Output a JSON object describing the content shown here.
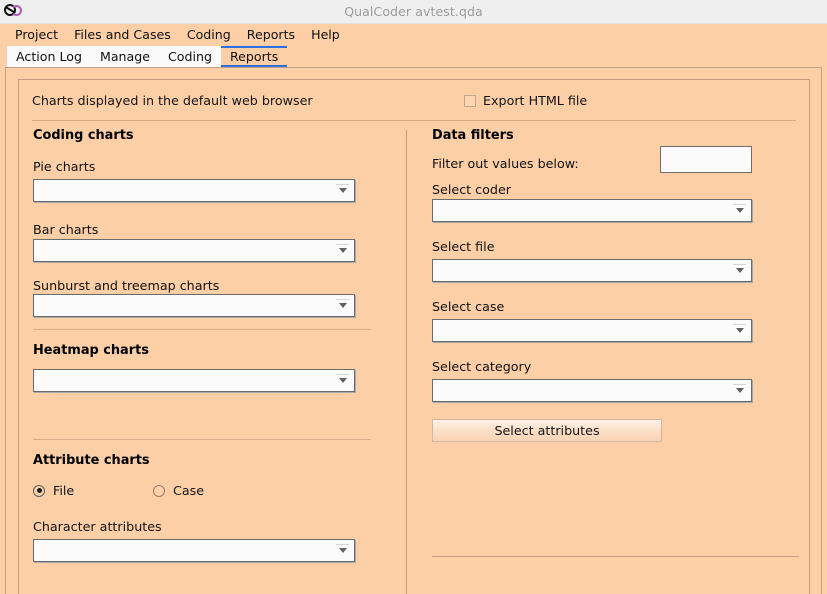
{
  "window": {
    "title": "QualCoder avtest.qda",
    "icon": "qualcoder-logo"
  },
  "menubar": {
    "items": [
      {
        "label": "Project"
      },
      {
        "label": "Files and Cases"
      },
      {
        "label": "Coding"
      },
      {
        "label": "Reports"
      },
      {
        "label": "Help"
      }
    ]
  },
  "tabs": {
    "items": [
      {
        "label": "Action Log",
        "active": false
      },
      {
        "label": "Manage",
        "active": false
      },
      {
        "label": "Coding",
        "active": false
      },
      {
        "label": "Reports",
        "active": true
      }
    ]
  },
  "header": {
    "info_label": "Charts displayed in the default web browser",
    "export_checkbox_label": "Export HTML file",
    "export_checkbox_checked": false
  },
  "coding_charts": {
    "heading": "Coding charts",
    "pie_label": "Pie charts",
    "pie_value": "",
    "bar_label": "Bar charts",
    "bar_value": "",
    "sunburst_label": "Sunburst and treemap charts",
    "sunburst_value": ""
  },
  "heatmap_charts": {
    "heading": "Heatmap charts",
    "value": ""
  },
  "attribute_charts": {
    "heading": "Attribute charts",
    "radio_file_label": "File",
    "radio_case_label": "Case",
    "selected": "File",
    "character_label": "Character attributes",
    "character_value": ""
  },
  "data_filters": {
    "heading": "Data filters",
    "filter_value_label": "Filter out values below:",
    "filter_value": "",
    "coder_label": "Select coder",
    "coder_value": "",
    "file_label": "Select file",
    "file_value": "",
    "case_label": "Select case",
    "case_value": "",
    "category_label": "Select category",
    "category_value": "",
    "attributes_button_label": "Select attributes"
  },
  "colors": {
    "background": "#fccfa6",
    "titlebar": "#efefef",
    "tab_accent": "#2f6ee0",
    "field_bg": "#fbfbfb",
    "divider": "#c79f7f"
  }
}
